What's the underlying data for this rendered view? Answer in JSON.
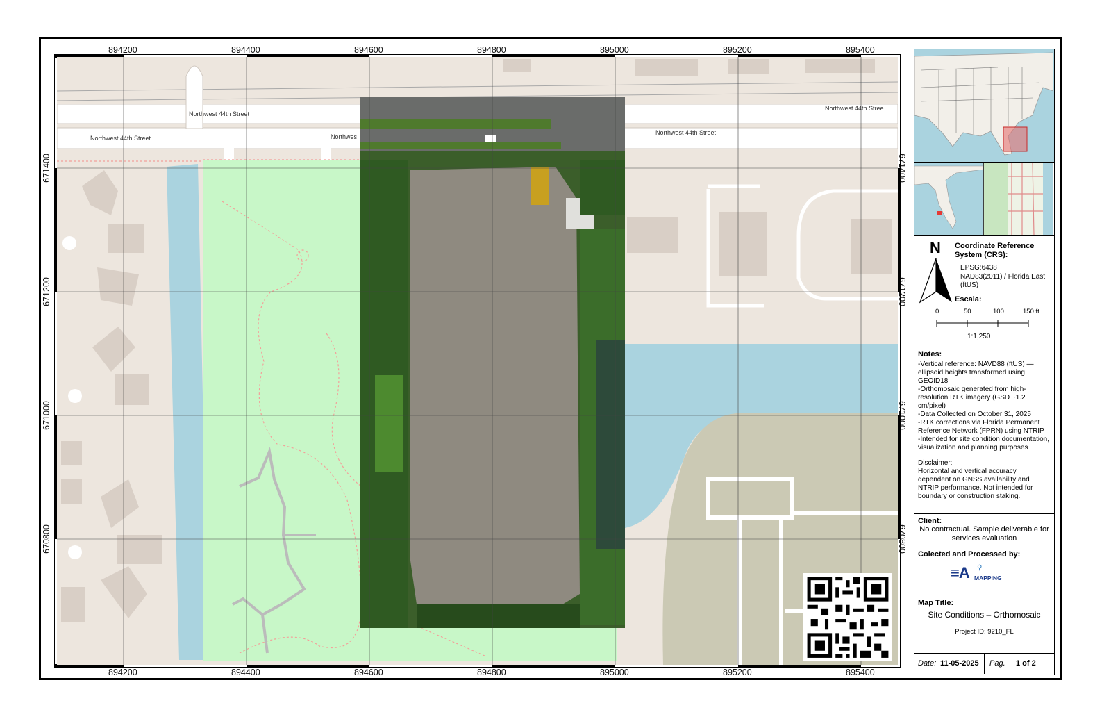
{
  "grid": {
    "x_labels": [
      "894200",
      "894400",
      "894600",
      "894800",
      "895000",
      "895200",
      "895400"
    ],
    "y_labels": [
      "671400",
      "671200",
      "671000",
      "670800"
    ]
  },
  "streets": {
    "north_lane_left": "Northwest 44th Street",
    "north_lane_right": "Northwest 44th Stree",
    "south_lane_left": "Northwest 44th Street",
    "south_lane_mid": "Northwes",
    "south_lane_right": "Northwest 44th Street"
  },
  "legend": {
    "north_letter": "N",
    "crs_title": "Coordinate Reference System (CRS):",
    "crs_code": "EPSG:6438",
    "crs_name": "NAD83(2011) / Florida East (ftUS)",
    "scale_title": "Escala:",
    "scale_ticks": [
      "0",
      "50",
      "100",
      "150 ft"
    ],
    "scale_ratio": "1:1,250"
  },
  "notes": {
    "title": "Notes:",
    "lines": [
      "-Vertical reference: NAVD88 (ftUS) — ellipsoid heights transformed using GEOID18",
      "-Orthomosaic generated from high-resolution RTK imagery (GSD ~1.2 cm/pixel)",
      "-Data Collected on October 31, 2025",
      "-RTK corrections via Florida Permanent Reference Network (FPRN) using NTRIP",
      "-Intended for site condition documentation, visualization and planning purposes"
    ],
    "disclaimer_title": "Disclaimer:",
    "disclaimer_text": "Horizontal and vertical accuracy dependent on GNSS availability and NTRIP performance. Not intended for boundary or construction staking."
  },
  "client": {
    "title": "Client:",
    "text": "No contractual. Sample deliverable for services evaluation"
  },
  "collected": {
    "title": "Colected and Processed by:",
    "logo_text": "MAPPING"
  },
  "map_title": {
    "title": "Map Title:",
    "text": "Site Conditions – Orthomosaic",
    "project": "Project ID: 9210_FL"
  },
  "footer": {
    "date_label": "Date:",
    "date_value": "11-05-2025",
    "page_label": "Pag.",
    "page_value": "1 of 2"
  },
  "colors": {
    "land": "#ede6de",
    "park": "#c8f7c8",
    "water": "#aad3df",
    "building": "#d9cfc6",
    "industrial": "#cbc9b4",
    "road": "#ffffff",
    "orthomosaic_cleared": "#8f8a80",
    "orthomosaic_trees": "#2f5a22"
  }
}
